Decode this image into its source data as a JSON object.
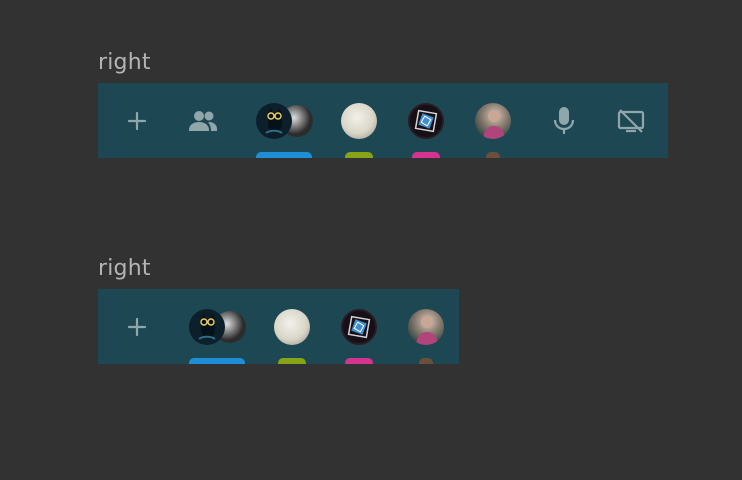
{
  "sections": [
    {
      "label": "right",
      "toolbar": {
        "add_icon": "plus-icon",
        "participants_icon": "people-icon",
        "mic_icon": "microphone-icon",
        "screen_icon": "screen-share-off-icon",
        "users": [
          {
            "avatar": "cat-avatar",
            "color": "#1e8fd6",
            "stacked": true
          },
          {
            "avatar": "moon-avatar",
            "color": "#87a316"
          },
          {
            "avatar": "spiral-avatar",
            "color": "#d6328f"
          },
          {
            "avatar": "person-avatar",
            "color": "#6b4f3c"
          }
        ]
      }
    },
    {
      "label": "right",
      "toolbar": {
        "add_icon": "plus-icon",
        "users": [
          {
            "avatar": "cat-avatar",
            "color": "#1e8fd6",
            "stacked": true
          },
          {
            "avatar": "moon-avatar",
            "color": "#87a316"
          },
          {
            "avatar": "spiral-avatar",
            "color": "#d6328f"
          },
          {
            "avatar": "person-avatar",
            "color": "#6b4f3c"
          }
        ]
      }
    }
  ],
  "colors": {
    "background": "#323232",
    "toolbar": "#1d4853",
    "icon": "#8fa6ab",
    "label": "#b4b4b4"
  }
}
